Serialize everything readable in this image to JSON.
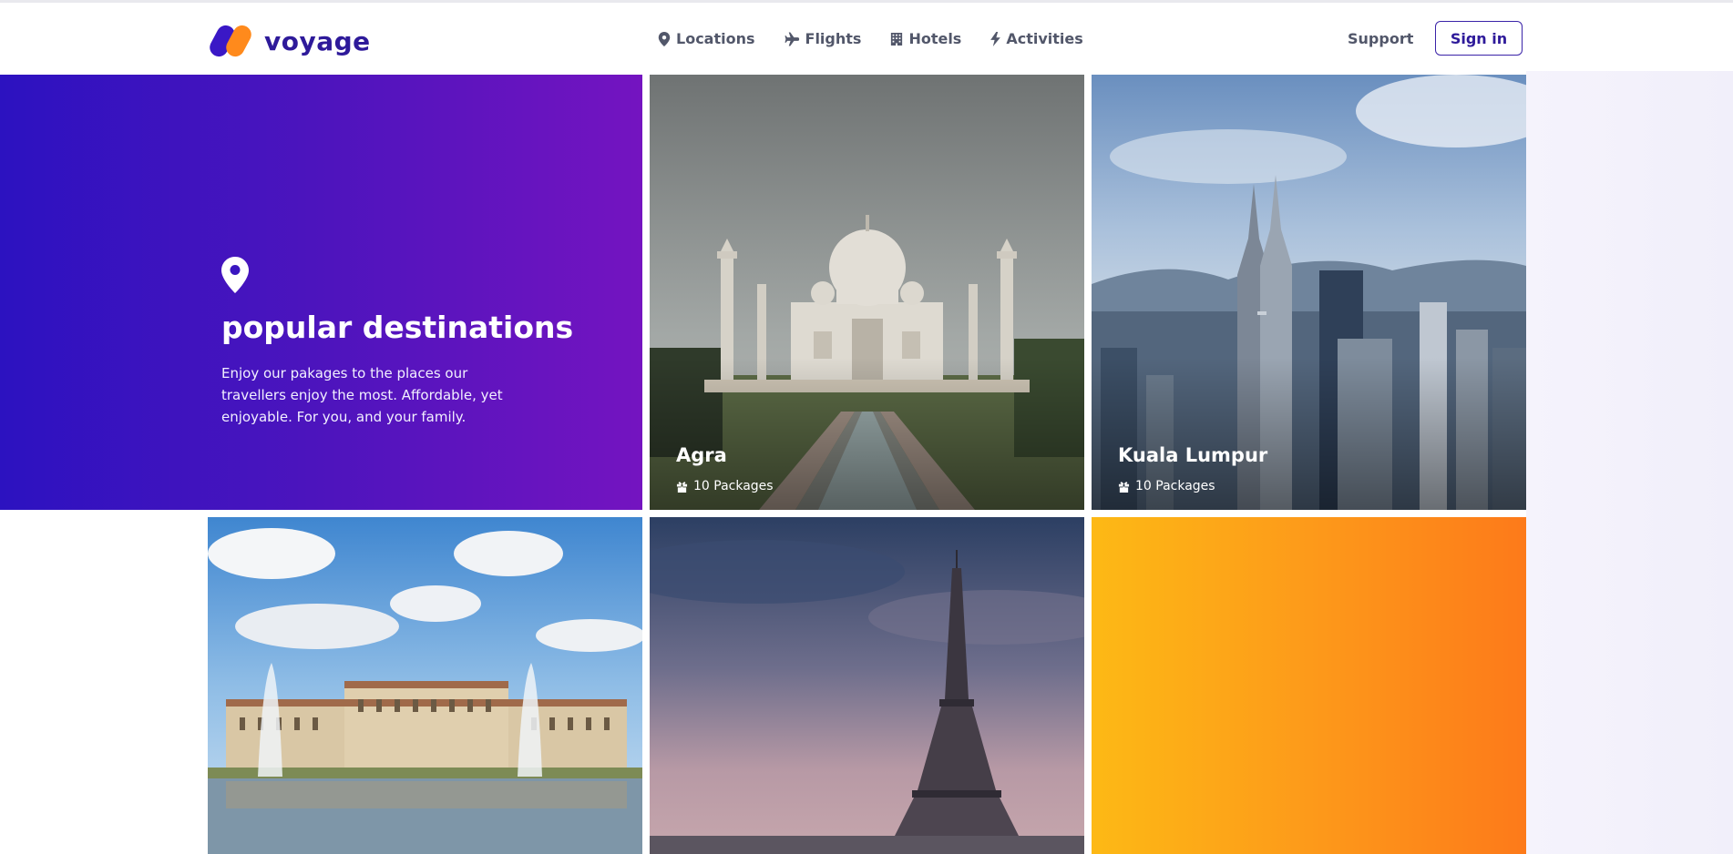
{
  "brand": {
    "name": "voyage"
  },
  "nav": {
    "items": [
      {
        "label": "Locations",
        "icon": "map-pin-icon"
      },
      {
        "label": "Flights",
        "icon": "plane-icon"
      },
      {
        "label": "Hotels",
        "icon": "building-icon"
      },
      {
        "label": "Activities",
        "icon": "bolt-icon"
      }
    ],
    "support_label": "Support",
    "signin_label": "Sign in"
  },
  "hero": {
    "icon": "map-pin-icon",
    "title": "popular destinations",
    "description": "Enjoy our pakages to the places our travellers enjoy the most. Affordable, yet enjoyable. For you, and your family."
  },
  "destinations": [
    {
      "name": "Agra",
      "packages": "10 Packages",
      "image": "taj-mahal-photo"
    },
    {
      "name": "Kuala Lumpur",
      "packages": "10 Packages",
      "image": "petronas-skyline-photo"
    },
    {
      "image": "palace-fountains-photo"
    },
    {
      "image": "eiffel-tower-photo"
    }
  ],
  "colors": {
    "brand_primary": "#2e1a9a",
    "brand_accent": "#ff8a1c",
    "hero_gradient_start": "#2c12c0",
    "hero_gradient_end": "#7414c0",
    "orange_gradient_start": "#fdb915",
    "orange_gradient_end": "#fd7a1a"
  }
}
